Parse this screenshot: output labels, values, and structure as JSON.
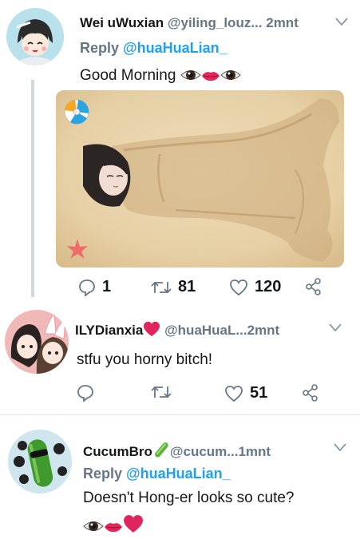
{
  "tweet1": {
    "name": "Wei uWuxian",
    "handle": "@yiling_louz...",
    "time": "2mnt",
    "reply_prefix": "Reply",
    "reply_to": "@huaHuaLian_",
    "text": "Good Morning",
    "emoji": [
      "eye-icon",
      "lips-icon",
      "eye-icon"
    ],
    "image": "beach-sand-illustration",
    "replies": "1",
    "retweets": "81",
    "likes": "120"
  },
  "tweet2": {
    "name": "ILYDianxia",
    "name_emoji": "heart-icon",
    "handle": "@huaHuaL...",
    "time": "2mnt",
    "text": "stfu you horny bitch!",
    "replies": "",
    "retweets": "",
    "likes": "51"
  },
  "tweet3": {
    "name": "CucumBro",
    "name_emoji": "cucumber-icon",
    "handle": "@cucum...",
    "time": "1mnt",
    "reply_prefix": "Reply",
    "reply_to": "@huaHuaLian_",
    "text": "Doesn't Hong-er looks so cute?",
    "emoji": [
      "eye-icon",
      "lips-icon",
      "heart-icon"
    ]
  },
  "colors": {
    "link": "#1da1f2",
    "muted": "#657786",
    "heart": "#e0245e",
    "sand": "#e5cfa8"
  }
}
